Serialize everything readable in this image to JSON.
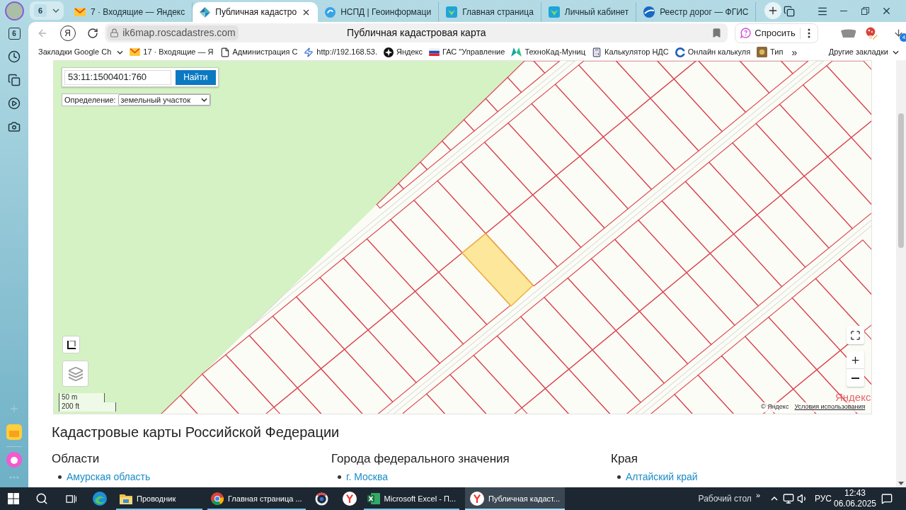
{
  "tab_strip": {
    "group_count": "6",
    "tabs": [
      {
        "title": "7 · Входящие — Яндекс",
        "selected": false
      },
      {
        "title": "Публичная кадастро",
        "selected": true
      },
      {
        "title": "НСПД | Геоинформаци",
        "selected": false
      },
      {
        "title": "Главная страница",
        "selected": false
      },
      {
        "title": "Личный кабинет",
        "selected": false
      },
      {
        "title": "Реестр дорог — ФГИС",
        "selected": false
      }
    ]
  },
  "toolbar": {
    "home_button": "Я",
    "url": "ik6map.roscadastres.com",
    "page_title": "Публичная кадастровая карта",
    "ask_button": "Спросить",
    "downloads_badge": "4"
  },
  "bookmarks_bar": {
    "items": [
      {
        "kind": "folder",
        "label": "Закладки Google Ch"
      },
      {
        "kind": "link",
        "label": "17 · Входящие — Я"
      },
      {
        "kind": "link",
        "label": "Администрация С"
      },
      {
        "kind": "link",
        "label": "http://192.168.53."
      },
      {
        "kind": "link",
        "label": "Яндекс"
      },
      {
        "kind": "link",
        "label": "ГАС \"Управление"
      },
      {
        "kind": "link",
        "label": "ТехноКад-Муниц"
      },
      {
        "kind": "link",
        "label": "Калькулятор НДС"
      },
      {
        "kind": "link",
        "label": "Онлайн калькуля"
      },
      {
        "kind": "link",
        "label": "Тип"
      }
    ],
    "overflow": "»",
    "other_bookmarks": "Другие закладки"
  },
  "sidebar": {
    "tabs_count": "6"
  },
  "map": {
    "search": {
      "value": "53:11:1500401:760"
    },
    "search_button": "Найти",
    "definition": {
      "label": "Определение:",
      "value": "земельный участок"
    },
    "scale": [
      "50 m",
      "200 ft"
    ],
    "logo": "Яндекс",
    "copyright": "© Яндекс",
    "terms_link": "Условия использования"
  },
  "page": {
    "heading": "Кадастровые карты Российской Федерации",
    "sections": [
      {
        "title": "Области",
        "links": [
          "Амурская область"
        ]
      },
      {
        "title": "Города федерального значения",
        "links": [
          "г. Москва"
        ]
      },
      {
        "title": "Края",
        "links": [
          "Алтайский край"
        ]
      }
    ]
  },
  "taskbar": {
    "apps": [
      {
        "label": "Проводник",
        "selected": false
      },
      {
        "label": "Главная страница ...",
        "selected": false
      },
      {
        "label": "Microsoft Excel - П...",
        "selected": false
      },
      {
        "label": "Публичная кадаст...",
        "selected": true
      }
    ],
    "desktop": "Рабочий стол",
    "overflow": "»",
    "language": "РУС",
    "time": "12:43",
    "date": "06.06.2025"
  }
}
